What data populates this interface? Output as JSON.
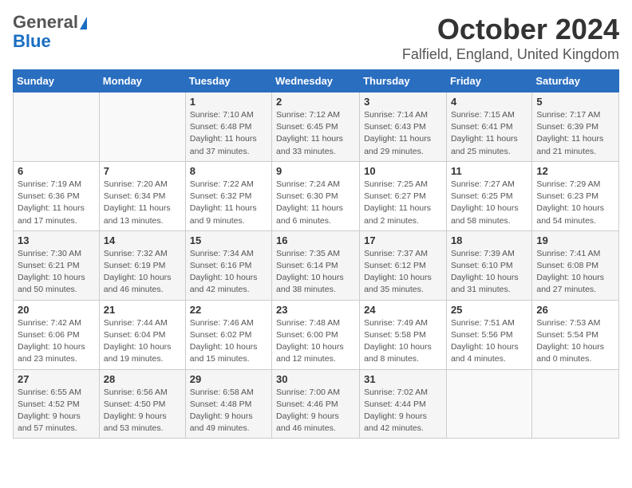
{
  "header": {
    "logo_general": "General",
    "logo_blue": "Blue",
    "title": "October 2024",
    "subtitle": "Falfield, England, United Kingdom"
  },
  "days_of_week": [
    "Sunday",
    "Monday",
    "Tuesday",
    "Wednesday",
    "Thursday",
    "Friday",
    "Saturday"
  ],
  "weeks": [
    [
      {
        "day": "",
        "detail": ""
      },
      {
        "day": "",
        "detail": ""
      },
      {
        "day": "1",
        "detail": "Sunrise: 7:10 AM\nSunset: 6:48 PM\nDaylight: 11 hours and 37 minutes."
      },
      {
        "day": "2",
        "detail": "Sunrise: 7:12 AM\nSunset: 6:45 PM\nDaylight: 11 hours and 33 minutes."
      },
      {
        "day": "3",
        "detail": "Sunrise: 7:14 AM\nSunset: 6:43 PM\nDaylight: 11 hours and 29 minutes."
      },
      {
        "day": "4",
        "detail": "Sunrise: 7:15 AM\nSunset: 6:41 PM\nDaylight: 11 hours and 25 minutes."
      },
      {
        "day": "5",
        "detail": "Sunrise: 7:17 AM\nSunset: 6:39 PM\nDaylight: 11 hours and 21 minutes."
      }
    ],
    [
      {
        "day": "6",
        "detail": "Sunrise: 7:19 AM\nSunset: 6:36 PM\nDaylight: 11 hours and 17 minutes."
      },
      {
        "day": "7",
        "detail": "Sunrise: 7:20 AM\nSunset: 6:34 PM\nDaylight: 11 hours and 13 minutes."
      },
      {
        "day": "8",
        "detail": "Sunrise: 7:22 AM\nSunset: 6:32 PM\nDaylight: 11 hours and 9 minutes."
      },
      {
        "day": "9",
        "detail": "Sunrise: 7:24 AM\nSunset: 6:30 PM\nDaylight: 11 hours and 6 minutes."
      },
      {
        "day": "10",
        "detail": "Sunrise: 7:25 AM\nSunset: 6:27 PM\nDaylight: 11 hours and 2 minutes."
      },
      {
        "day": "11",
        "detail": "Sunrise: 7:27 AM\nSunset: 6:25 PM\nDaylight: 10 hours and 58 minutes."
      },
      {
        "day": "12",
        "detail": "Sunrise: 7:29 AM\nSunset: 6:23 PM\nDaylight: 10 hours and 54 minutes."
      }
    ],
    [
      {
        "day": "13",
        "detail": "Sunrise: 7:30 AM\nSunset: 6:21 PM\nDaylight: 10 hours and 50 minutes."
      },
      {
        "day": "14",
        "detail": "Sunrise: 7:32 AM\nSunset: 6:19 PM\nDaylight: 10 hours and 46 minutes."
      },
      {
        "day": "15",
        "detail": "Sunrise: 7:34 AM\nSunset: 6:16 PM\nDaylight: 10 hours and 42 minutes."
      },
      {
        "day": "16",
        "detail": "Sunrise: 7:35 AM\nSunset: 6:14 PM\nDaylight: 10 hours and 38 minutes."
      },
      {
        "day": "17",
        "detail": "Sunrise: 7:37 AM\nSunset: 6:12 PM\nDaylight: 10 hours and 35 minutes."
      },
      {
        "day": "18",
        "detail": "Sunrise: 7:39 AM\nSunset: 6:10 PM\nDaylight: 10 hours and 31 minutes."
      },
      {
        "day": "19",
        "detail": "Sunrise: 7:41 AM\nSunset: 6:08 PM\nDaylight: 10 hours and 27 minutes."
      }
    ],
    [
      {
        "day": "20",
        "detail": "Sunrise: 7:42 AM\nSunset: 6:06 PM\nDaylight: 10 hours and 23 minutes."
      },
      {
        "day": "21",
        "detail": "Sunrise: 7:44 AM\nSunset: 6:04 PM\nDaylight: 10 hours and 19 minutes."
      },
      {
        "day": "22",
        "detail": "Sunrise: 7:46 AM\nSunset: 6:02 PM\nDaylight: 10 hours and 15 minutes."
      },
      {
        "day": "23",
        "detail": "Sunrise: 7:48 AM\nSunset: 6:00 PM\nDaylight: 10 hours and 12 minutes."
      },
      {
        "day": "24",
        "detail": "Sunrise: 7:49 AM\nSunset: 5:58 PM\nDaylight: 10 hours and 8 minutes."
      },
      {
        "day": "25",
        "detail": "Sunrise: 7:51 AM\nSunset: 5:56 PM\nDaylight: 10 hours and 4 minutes."
      },
      {
        "day": "26",
        "detail": "Sunrise: 7:53 AM\nSunset: 5:54 PM\nDaylight: 10 hours and 0 minutes."
      }
    ],
    [
      {
        "day": "27",
        "detail": "Sunrise: 6:55 AM\nSunset: 4:52 PM\nDaylight: 9 hours and 57 minutes."
      },
      {
        "day": "28",
        "detail": "Sunrise: 6:56 AM\nSunset: 4:50 PM\nDaylight: 9 hours and 53 minutes."
      },
      {
        "day": "29",
        "detail": "Sunrise: 6:58 AM\nSunset: 4:48 PM\nDaylight: 9 hours and 49 minutes."
      },
      {
        "day": "30",
        "detail": "Sunrise: 7:00 AM\nSunset: 4:46 PM\nDaylight: 9 hours and 46 minutes."
      },
      {
        "day": "31",
        "detail": "Sunrise: 7:02 AM\nSunset: 4:44 PM\nDaylight: 9 hours and 42 minutes."
      },
      {
        "day": "",
        "detail": ""
      },
      {
        "day": "",
        "detail": ""
      }
    ]
  ]
}
